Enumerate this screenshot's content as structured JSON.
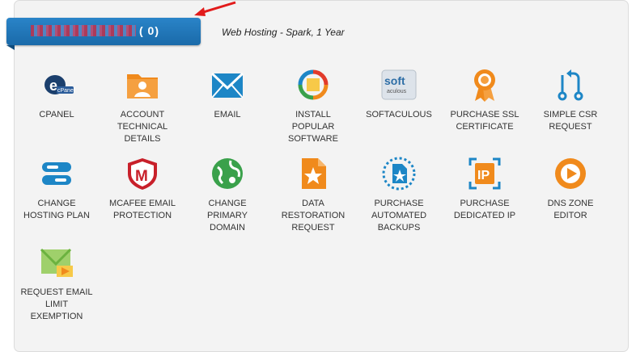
{
  "account": {
    "badge_text": "(   0)",
    "plan": "Web Hosting - Spark, 1 Year"
  },
  "colors": {
    "ribbon": "#1f77bb",
    "icon_blue": "#1d86c6",
    "icon_orange": "#f08a1c",
    "pointer_arrow": "#e21b1b"
  },
  "tools": [
    {
      "label": "CPANEL",
      "icon": "cpanel-icon"
    },
    {
      "label": "ACCOUNT TECHNICAL DETAILS",
      "icon": "account-details-icon"
    },
    {
      "label": "EMAIL",
      "icon": "envelope-icon"
    },
    {
      "label": "INSTALL POPULAR SOFTWARE",
      "icon": "software-installer-icon"
    },
    {
      "label": "SOFTACULOUS",
      "icon": "softaculous-icon"
    },
    {
      "label": "PURCHASE SSL CERTIFICATE",
      "icon": "ribbon-award-icon"
    },
    {
      "label": "SIMPLE CSR REQUEST",
      "icon": "csr-arrows-icon"
    },
    {
      "label": "CHANGE HOSTING PLAN",
      "icon": "hosting-plan-icon"
    },
    {
      "label": "MCAFEE EMAIL PROTECTION",
      "icon": "mcafee-shield-icon"
    },
    {
      "label": "CHANGE PRIMARY DOMAIN",
      "icon": "globe-icon"
    },
    {
      "label": "DATA RESTORATION REQUEST",
      "icon": "file-star-icon"
    },
    {
      "label": "PURCHASE AUTOMATED BACKUPS",
      "icon": "backup-file-icon"
    },
    {
      "label": "PURCHASE DEDICATED IP",
      "icon": "ip-icon"
    },
    {
      "label": "DNS ZONE EDITOR",
      "icon": "dns-play-icon"
    },
    {
      "label": "REQUEST EMAIL LIMIT EXEMPTION",
      "icon": "email-arrow-icon"
    }
  ]
}
